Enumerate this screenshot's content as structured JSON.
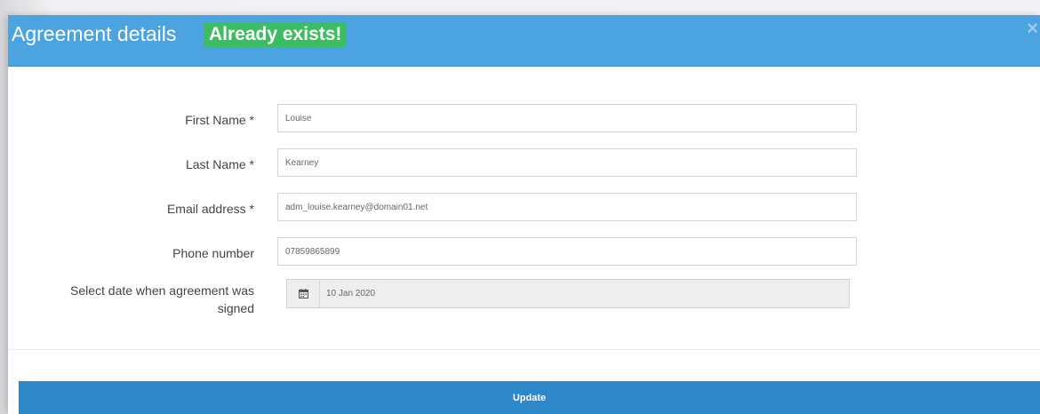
{
  "header": {
    "title": "Agreement details",
    "badge": "Already exists!",
    "close_icon": "close-icon",
    "background_color": "#4ba3df",
    "badge_color": "#3dbd61"
  },
  "form": {
    "first_name": {
      "label": "First Name *",
      "value": "Louise"
    },
    "last_name": {
      "label": "Last Name *",
      "value": "Kearney"
    },
    "email": {
      "label": "Email address *",
      "value": "adm_louise.kearney@domain01.net"
    },
    "phone": {
      "label": "Phone number",
      "value": "07859865899"
    },
    "date": {
      "label_line1": "Select date when agreement was",
      "label_line2": "signed",
      "value": "10 Jan 2020",
      "icon": "calendar-icon"
    }
  },
  "footer": {
    "update_label": "Update",
    "button_color": "#2e87c8"
  }
}
